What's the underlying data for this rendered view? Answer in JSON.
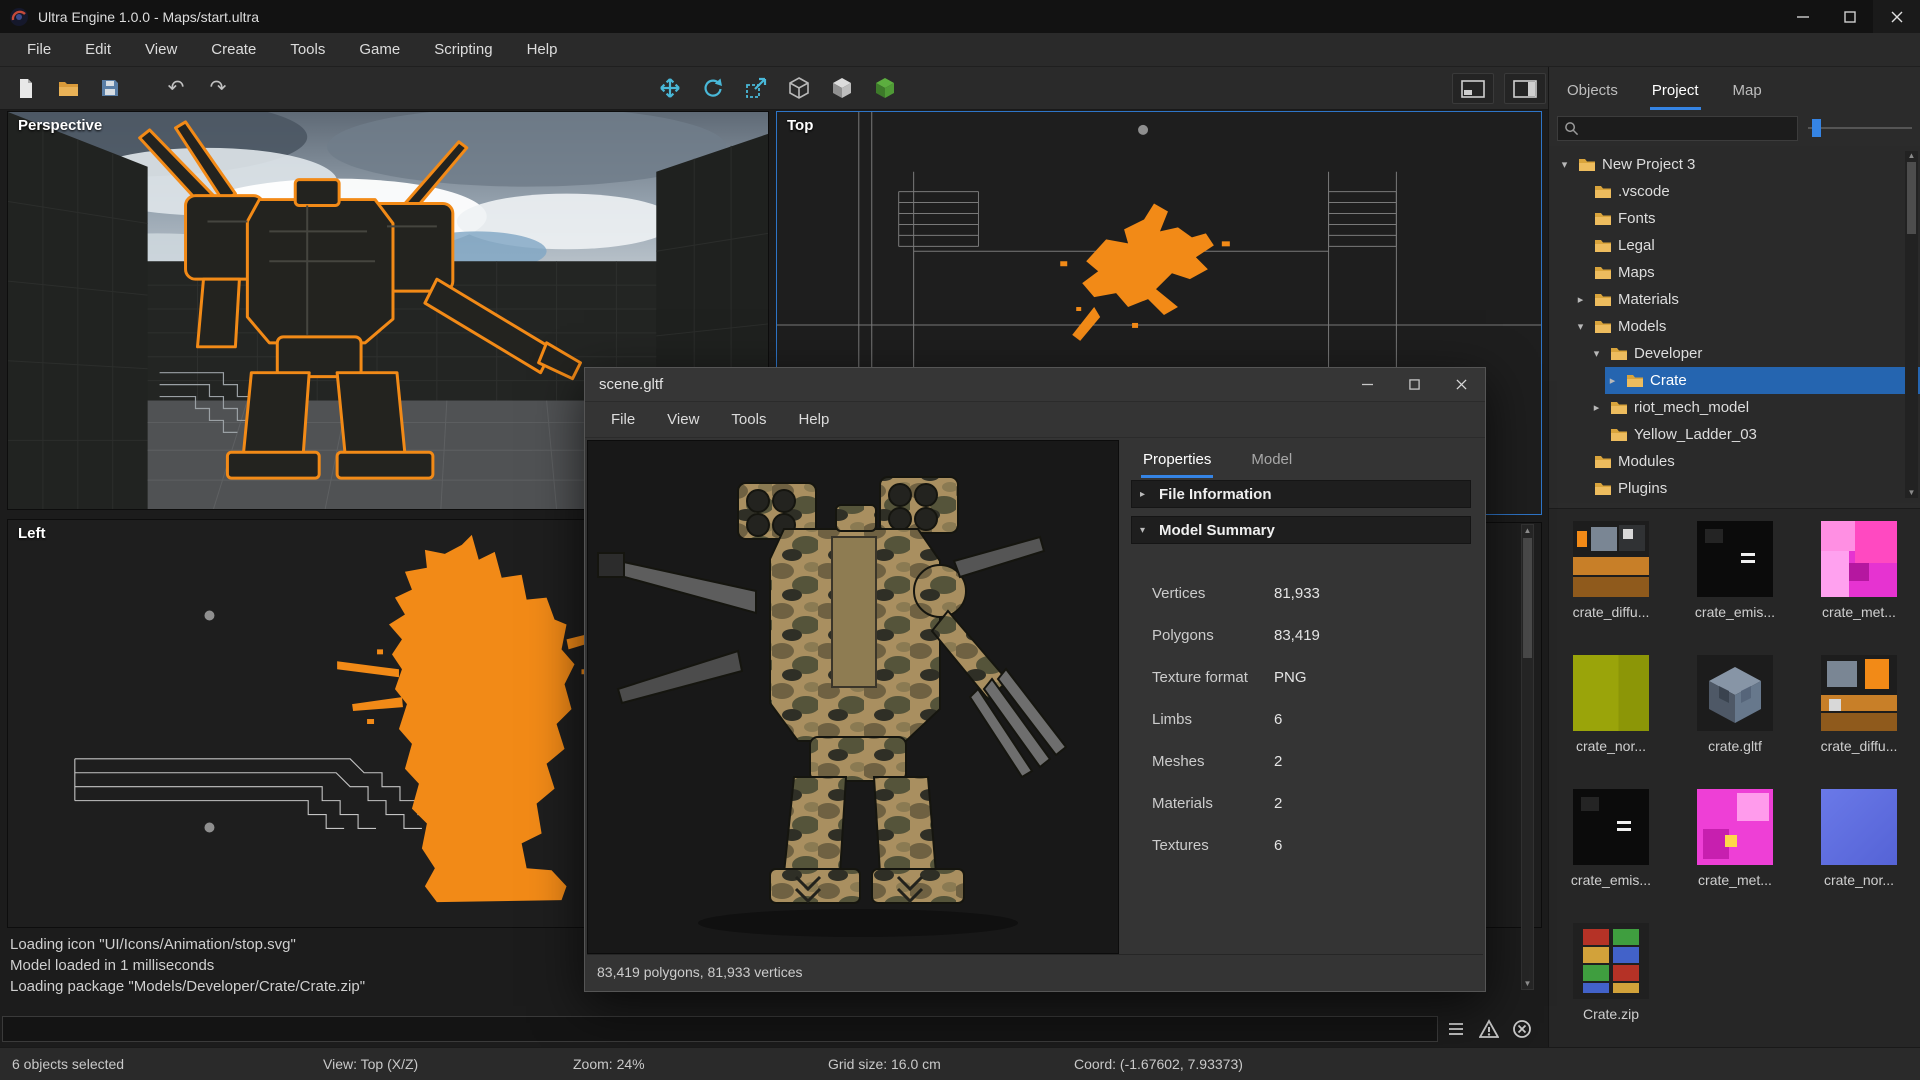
{
  "colors": {
    "accent": "#3584e4",
    "selection_orange": "#f28a17",
    "tree_selection": "#2565b0"
  },
  "titlebar": {
    "title": "Ultra Engine 1.0.0 - Maps/start.ultra"
  },
  "menubar": {
    "items": [
      "File",
      "Edit",
      "View",
      "Create",
      "Tools",
      "Game",
      "Scripting",
      "Help"
    ]
  },
  "viewports": {
    "perspective": "Perspective",
    "top": "Top",
    "left": "Left"
  },
  "dialog": {
    "title": "scene.gltf",
    "menu": [
      "File",
      "View",
      "Tools",
      "Help"
    ],
    "tabs": [
      "Properties",
      "Model"
    ],
    "active_tab": "Properties",
    "sections": {
      "file_information": "File Information",
      "model_summary": "Model Summary"
    },
    "properties": [
      {
        "label": "Vertices",
        "value": "81,933"
      },
      {
        "label": "Polygons",
        "value": "83,419"
      },
      {
        "label": "Texture format",
        "value": "PNG"
      },
      {
        "label": "Limbs",
        "value": "6"
      },
      {
        "label": "Meshes",
        "value": "2"
      },
      {
        "label": "Materials",
        "value": "2"
      },
      {
        "label": "Textures",
        "value": "6"
      }
    ],
    "status": "83,419 polygons, 81,933 vertices"
  },
  "sidebar": {
    "tabs": [
      "Objects",
      "Project",
      "Map"
    ],
    "active_tab": "Project",
    "tree": [
      "New Project 3",
      ".vscode",
      "Fonts",
      "Legal",
      "Maps",
      "Materials",
      "Models",
      "Developer",
      "Crate",
      "riot_mech_model",
      "Yellow_Ladder_03",
      "Modules",
      "Plugins"
    ],
    "selected_item": "Crate",
    "assets": [
      "crate_diffu...",
      "crate_emis...",
      "crate_met...",
      "crate_nor...",
      "crate.gltf",
      "crate_diffu...",
      "crate_emis...",
      "crate_met...",
      "crate_nor...",
      "Crate.zip"
    ]
  },
  "console": {
    "lines": [
      "Loading icon \"UI/Icons/Animation/stop.svg\"",
      "Model loaded in 1 milliseconds",
      "Loading package \"Models/Developer/Crate/Crate.zip\""
    ]
  },
  "statusbar": {
    "selection": "6 objects selected",
    "view": "View: Top (X/Z)",
    "zoom": "Zoom: 24%",
    "grid": "Grid size: 16.0 cm",
    "coord": "Coord: (-1.67602, 7.93373)"
  }
}
